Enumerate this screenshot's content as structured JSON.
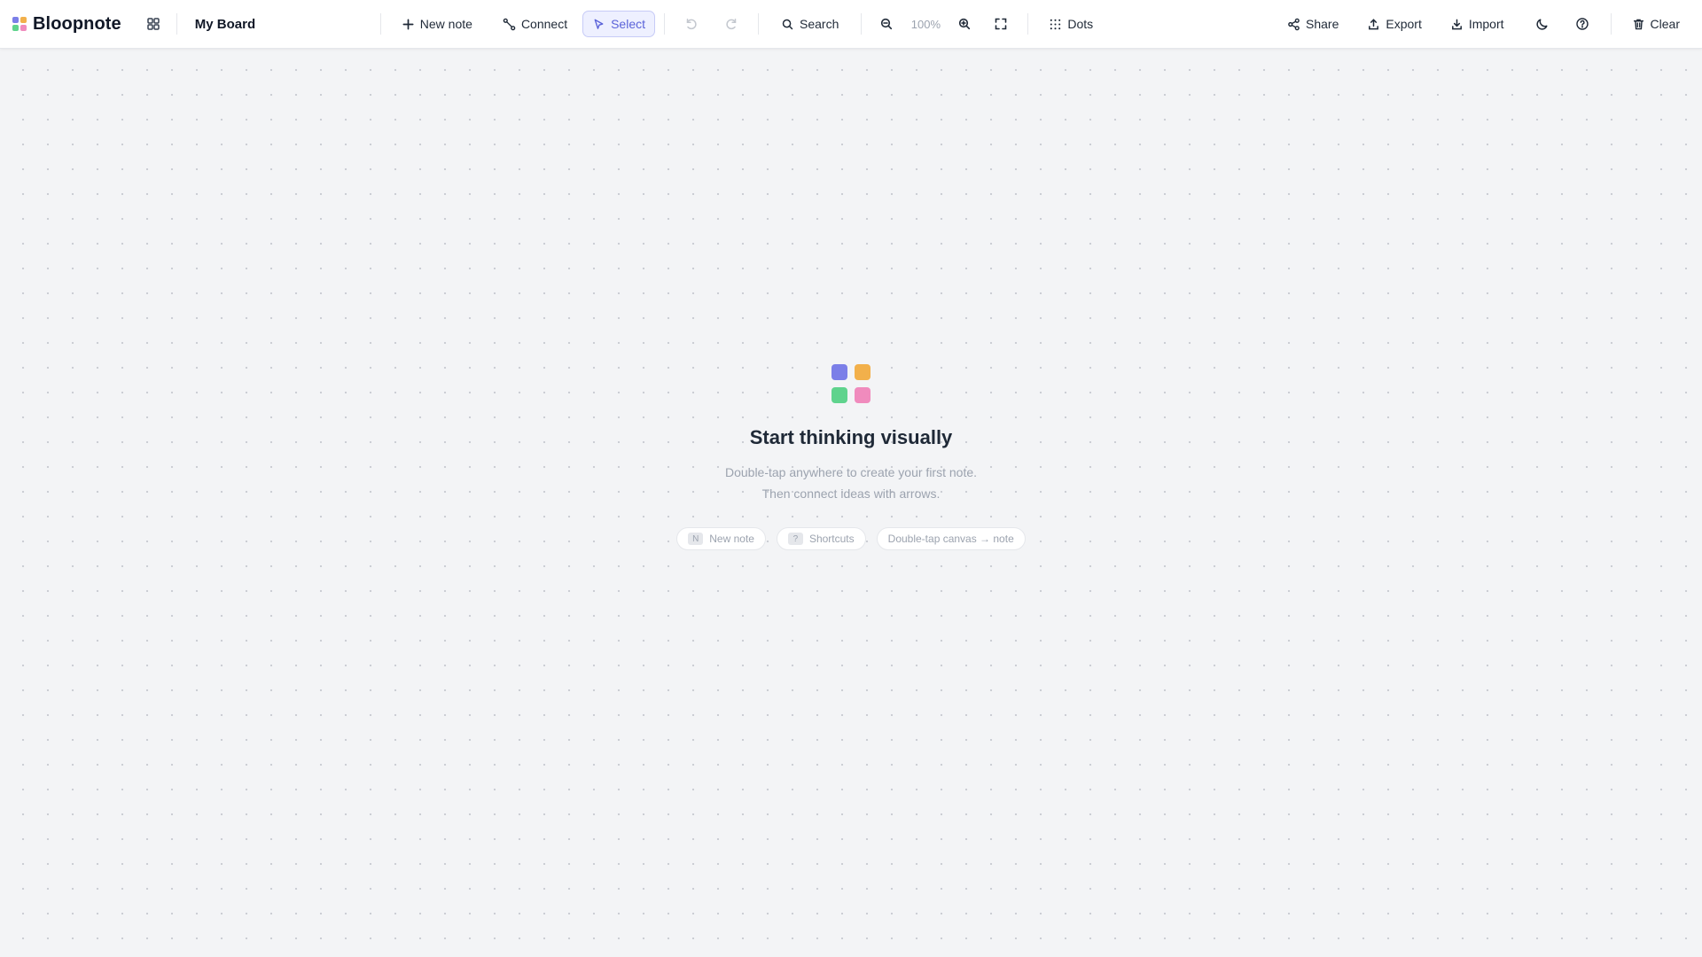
{
  "app": {
    "name": "Bloopnote"
  },
  "colors": {
    "accent": "#5b63d9",
    "logo": [
      "#7b7fe8",
      "#f2b04b",
      "#5fd38d",
      "#f08bbd"
    ],
    "canvas": "#f3f4f6",
    "dot": "#c9ccd2"
  },
  "toolbar": {
    "board_title": "My Board",
    "boards_icon": "grid-icon",
    "new_note": "New note",
    "connect": "Connect",
    "select": "Select",
    "search": "Search",
    "zoom": "100%",
    "grid_style": "Dots",
    "share": "Share",
    "export": "Export",
    "import": "Import",
    "clear": "Clear"
  },
  "empty_state": {
    "title": "Start thinking visually",
    "line1": "Double-tap anywhere to create your first note.",
    "line2": "Then connect ideas with arrows.",
    "hints": [
      {
        "key": "N",
        "label": "New note"
      },
      {
        "key": "?",
        "label": "Shortcuts"
      },
      {
        "key": "",
        "label": "Double-tap canvas → note"
      }
    ]
  }
}
